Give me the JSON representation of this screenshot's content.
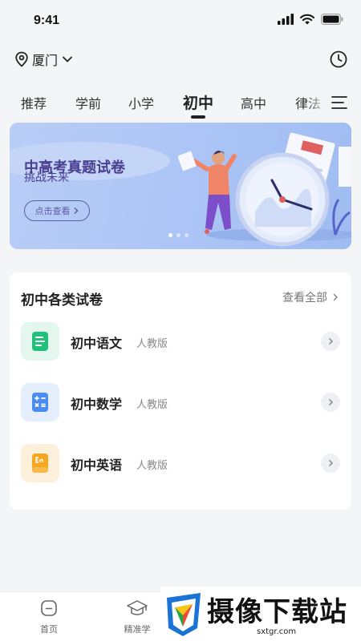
{
  "status_bar": {
    "time": "9:41"
  },
  "header": {
    "location": "厦门"
  },
  "tabs": [
    {
      "label": "推荐",
      "active": false
    },
    {
      "label": "学前",
      "active": false
    },
    {
      "label": "小学",
      "active": false
    },
    {
      "label": "初中",
      "active": true
    },
    {
      "label": "高中",
      "active": false
    },
    {
      "label": "律法",
      "active": false
    }
  ],
  "banner": {
    "title": "中高考真题试卷",
    "subtitle": "挑战未来",
    "button_label": "点击查看",
    "slides": 3,
    "active_slide": 1
  },
  "section": {
    "title": "初中各类试卷",
    "see_all": "查看全部",
    "items": [
      {
        "title": "初中语文",
        "edition": "人教版",
        "icon": "document-icon",
        "color": "#22c07a",
        "bg": "#e3f7ee"
      },
      {
        "title": "初中数学",
        "edition": "人教版",
        "icon": "calculator-icon",
        "color": "#4a8cf0",
        "bg": "#e4eefc"
      },
      {
        "title": "初中英语",
        "edition": "人教版",
        "icon": "english-book-icon",
        "color": "#f5a623",
        "bg": "#fdf1dc"
      }
    ]
  },
  "bottom_nav": [
    {
      "label": "首页",
      "icon": "home-icon"
    },
    {
      "label": "精准学",
      "icon": "graduation-cap-icon"
    }
  ],
  "watermark": {
    "text": "摄像下载站",
    "url": "sxtgr.com"
  }
}
